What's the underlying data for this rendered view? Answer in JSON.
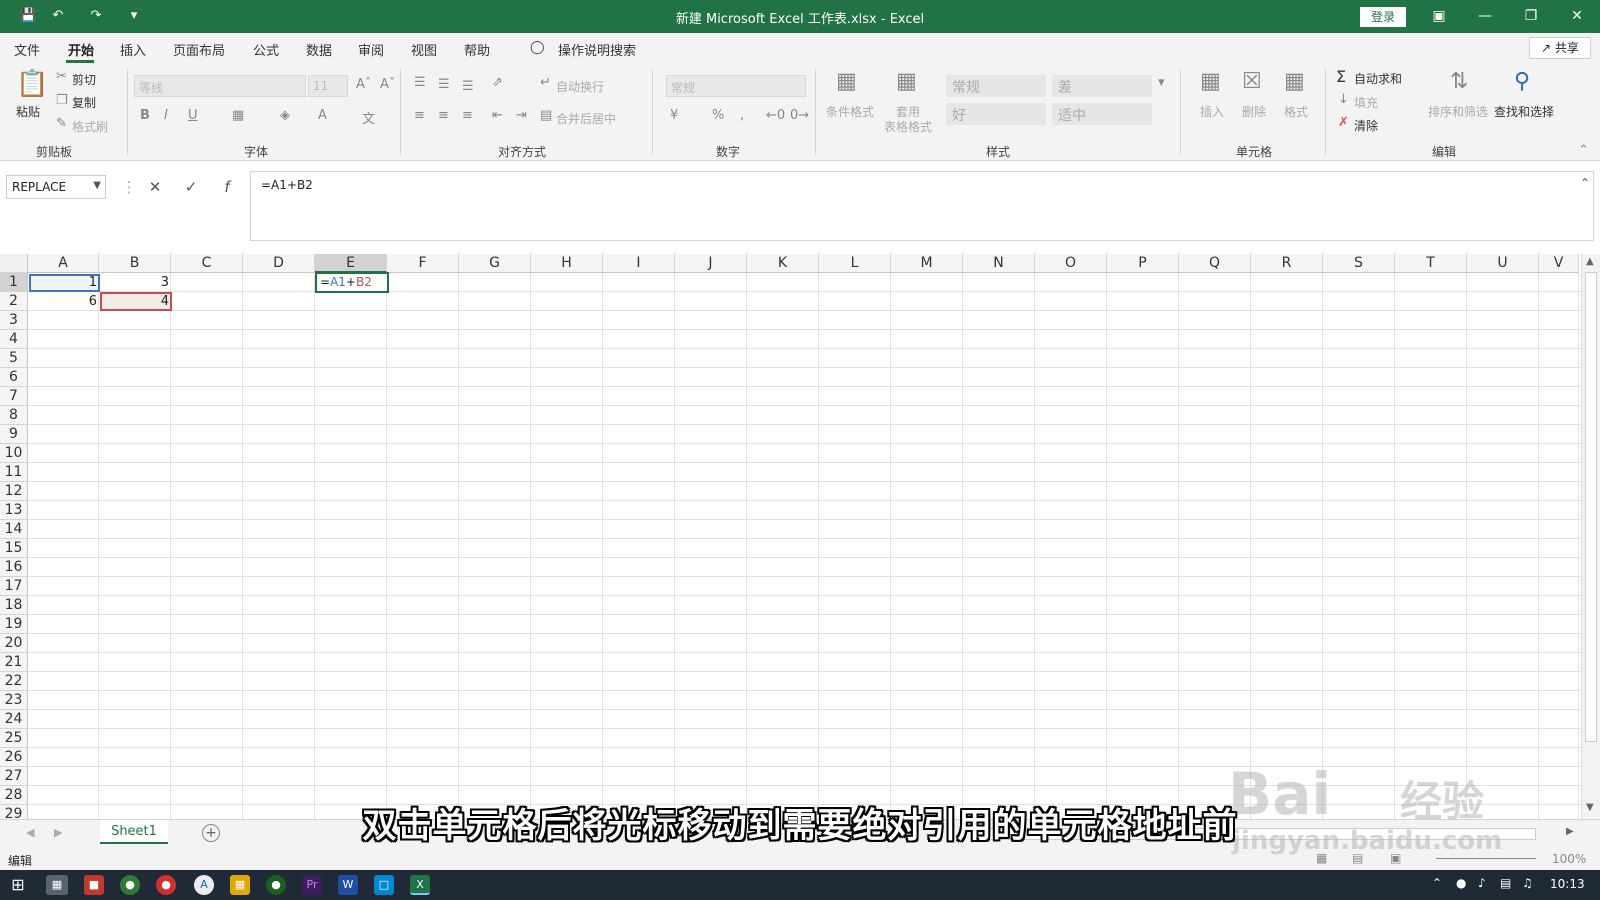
{
  "window": {
    "title": "新建 Microsoft Excel 工作表.xlsx  -  Excel",
    "login": "登录"
  },
  "menu": {
    "tabs": [
      "文件",
      "开始",
      "插入",
      "页面布局",
      "公式",
      "数据",
      "审阅",
      "视图",
      "帮助"
    ],
    "search": "操作说明搜索",
    "share": "共享"
  },
  "ribbon": {
    "clipboard": {
      "paste": "粘贴",
      "cut": "剪切",
      "copy": "复制",
      "format_painter": "格式刷",
      "label": "剪贴板"
    },
    "font": {
      "name": "等线",
      "size": "11",
      "label": "字体"
    },
    "alignment": {
      "wrap": "自动换行",
      "merge": "合并后居中",
      "label": "对齐方式"
    },
    "number": {
      "format": "常规",
      "label": "数字"
    },
    "styles": {
      "cond_format": "条件格式",
      "table_format_1": "套用",
      "table_format_2": "表格格式",
      "normal": "常规",
      "bad": "差",
      "good": "好",
      "neutral": "适中",
      "label": "样式"
    },
    "cells": {
      "insert": "插入",
      "delete": "删除",
      "format": "格式",
      "label": "单元格"
    },
    "editing": {
      "autosum": "自动求和",
      "fill": "填充",
      "clear": "清除",
      "sort_filter": "排序和筛选",
      "find_select": "查找和选择",
      "label": "编辑"
    }
  },
  "formula_bar": {
    "name_box": "REPLACE",
    "formula": "=A1+B2"
  },
  "grid": {
    "columns": [
      "A",
      "B",
      "C",
      "D",
      "E",
      "F",
      "G",
      "H",
      "I",
      "J",
      "K",
      "L",
      "M",
      "N",
      "O",
      "P",
      "Q",
      "R",
      "S",
      "T",
      "U",
      "V"
    ],
    "rows": [
      "1",
      "2",
      "3",
      "4",
      "5",
      "6",
      "7",
      "8",
      "9",
      "10",
      "11",
      "12",
      "13",
      "14",
      "15",
      "16",
      "17",
      "18",
      "19",
      "20",
      "21",
      "22",
      "23",
      "24",
      "25",
      "26",
      "27",
      "28",
      "29"
    ],
    "cells": {
      "A1": "1",
      "B1": "3",
      "A2": "6",
      "B2": "4"
    },
    "edit_cell": {
      "ref1": "A1",
      "op": "+",
      "ref2": "B2"
    }
  },
  "sheets": [
    "Sheet1"
  ],
  "status": {
    "mode": "编辑",
    "zoom": "100%"
  },
  "taskbar": {
    "time": "10:13"
  },
  "caption": "双击单元格后将光标移动到需要绝对引用的单元格地址前",
  "watermark": {
    "brand": "Bai",
    "brand2": "经验",
    "url": "jingyan.baidu.com"
  },
  "colors": {
    "excel_green": "#217346",
    "ref_blue": "#4472c4",
    "ref_red": "#c0504d"
  }
}
